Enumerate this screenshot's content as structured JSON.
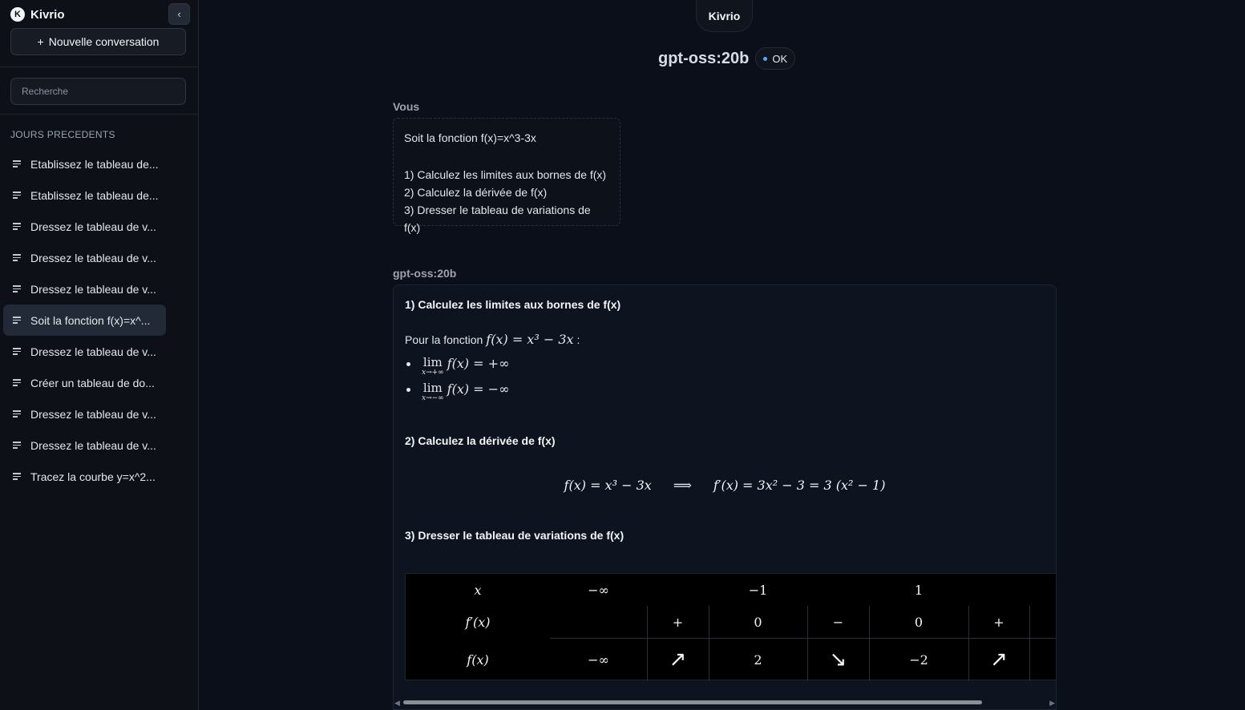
{
  "sidebar": {
    "brand_logo": "K",
    "brand_name": "Kivrio",
    "collapse_icon": "‹",
    "new_conversation": "Nouvelle conversation",
    "new_conversation_icon": "+",
    "search_placeholder": "Recherche",
    "section_title": "JOURS PRECEDENTS",
    "items": [
      {
        "label": "Etablissez le tableau de..."
      },
      {
        "label": "Etablissez le tableau de..."
      },
      {
        "label": "Dressez le tableau de v..."
      },
      {
        "label": "Dressez le tableau de v..."
      },
      {
        "label": "Dressez le tableau de v..."
      },
      {
        "label": "Soit la fonction f(x)=x^..."
      },
      {
        "label": "Dressez le tableau de v..."
      },
      {
        "label": "Créer un tableau de do..."
      },
      {
        "label": "Dressez le tableau de v..."
      },
      {
        "label": "Dressez le tableau de v..."
      },
      {
        "label": "Tracez la courbe y=x^2..."
      }
    ],
    "active_index": 5
  },
  "header": {
    "app_pill": "Kivrio",
    "model_name": "gpt-oss:20b",
    "status": "OK",
    "status_color": "#60a5fa"
  },
  "conversation": {
    "user_label": "Vous",
    "user_lines": [
      "Soit la fonction f(x)=x^3-3x",
      "1) Calculez les limites aux bornes de f(x)",
      "2) Calculez la dérivée de f(x)",
      "3) Dresser le tableau de variations de f(x)"
    ],
    "bot_label": "gpt-oss:20b",
    "bot": {
      "h1": "1) Calculez les limites aux bornes de f(x)",
      "intro_text": "Pour la fonction",
      "intro_math": "f(x) = x³ − 3x",
      "intro_colon": ":",
      "lim1_op": "lim",
      "lim1_sub": "x→+∞",
      "lim1_expr": "f(x) = +∞",
      "lim2_op": "lim",
      "lim2_sub": "x→−∞",
      "lim2_expr": "f(x) = −∞",
      "h2": "2) Calculez la dérivée de f(x)",
      "eq_left": "f(x) = x³ − 3x",
      "eq_imp": "⟹",
      "eq_right": "f′(x) = 3x² − 3 = 3 (x² − 1)",
      "h3": "3) Dresser le tableau de variations de f(x)",
      "table": {
        "row_x": "x",
        "row_fp": "f′(x)",
        "row_f": "f(x)",
        "x_vals": [
          "−∞",
          "−1",
          "1"
        ],
        "fp_vals": [
          "+",
          "0",
          "−",
          "0",
          "+"
        ],
        "f_vals": [
          "−∞",
          "↗",
          "2",
          "↘",
          "−2",
          "↗"
        ]
      }
    }
  }
}
